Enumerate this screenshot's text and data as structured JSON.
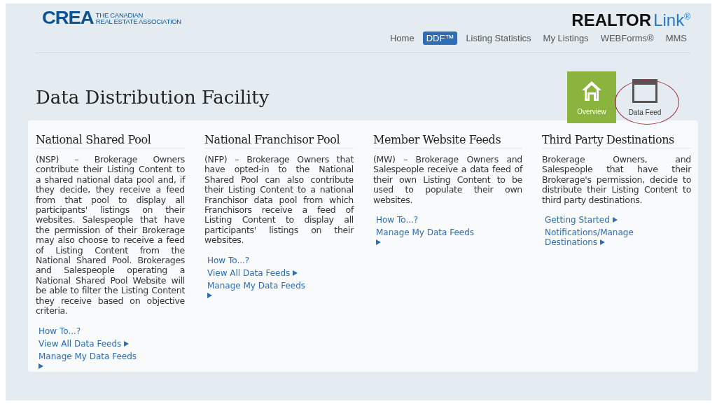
{
  "header": {
    "logo_mark": "CREA",
    "logo_line_1": "THE CANADIAN",
    "logo_line_2": "REAL ESTATE ASSOCIATION",
    "brand": "REALTOR",
    "brand_accent": "Link",
    "brand_mark": "®"
  },
  "nav": [
    {
      "label": "Home",
      "selected": false
    },
    {
      "label": "DDF™",
      "selected": true
    },
    {
      "label": "Listing Statistics",
      "selected": false
    },
    {
      "label": "My Listings",
      "selected": false
    },
    {
      "label": "WEBForms®",
      "selected": false
    },
    {
      "label": "MMS",
      "selected": false
    }
  ],
  "page_title": "Data Distribution Facility",
  "views": [
    {
      "label": "Overview",
      "kind": "home",
      "selected": true,
      "circled": false
    },
    {
      "label": "Data Feed",
      "kind": "window",
      "selected": false,
      "circled": true
    }
  ],
  "sections": [
    {
      "title": "National Shared Pool",
      "body": "(NSP) – Brokerage Owners contribute their Listing Content to a shared national data pool and, if they decide, they receive a feed from that pool to display all participants' listings on their websites. Salespeople that have the permission of their Brokerage may also choose to receive a feed of Listing Content from the National Shared Pool. Brokerages and Salespeople operating a National Shared Pool Website will be able to filter the Listing Content they receive based on objective criteria.",
      "links": [
        {
          "label": "How To...?",
          "arrow": false
        },
        {
          "label": "View All Data Feeds",
          "arrow": true
        },
        {
          "label": "Manage My Data Feeds",
          "arrow": true
        }
      ]
    },
    {
      "title": "National Franchisor Pool",
      "body": "(NFP) – Brokerage Owners that have opted-in to the National Shared Pool can also contribute their Listing Content to a national Franchisor data pool from which Franchisors receive a feed of Listing Content to display all participants' listings on their websites.",
      "links": [
        {
          "label": "How To...?",
          "arrow": false
        },
        {
          "label": "View All Data Feeds",
          "arrow": true
        },
        {
          "label": "Manage My Data Feeds",
          "arrow": true
        }
      ]
    },
    {
      "title": "Member Website Feeds",
      "body": "(MW) – Brokerage Owners and Salespeople receive a data feed of their own Listing Content to be used to populate their own websites.",
      "links": [
        {
          "label": "How To...?",
          "arrow": false
        },
        {
          "label": "Manage My Data Feeds",
          "arrow": true
        }
      ]
    },
    {
      "title": "Third Party Destinations",
      "body": "Brokerage Owners, and Salespeople that have their Brokerage's permission, decide to distribute their Listing Content to third party destinations.",
      "links": [
        {
          "label": "Getting Started",
          "arrow": true
        },
        {
          "label": "Notifications/Manage Destinations",
          "arrow": true
        }
      ]
    }
  ]
}
